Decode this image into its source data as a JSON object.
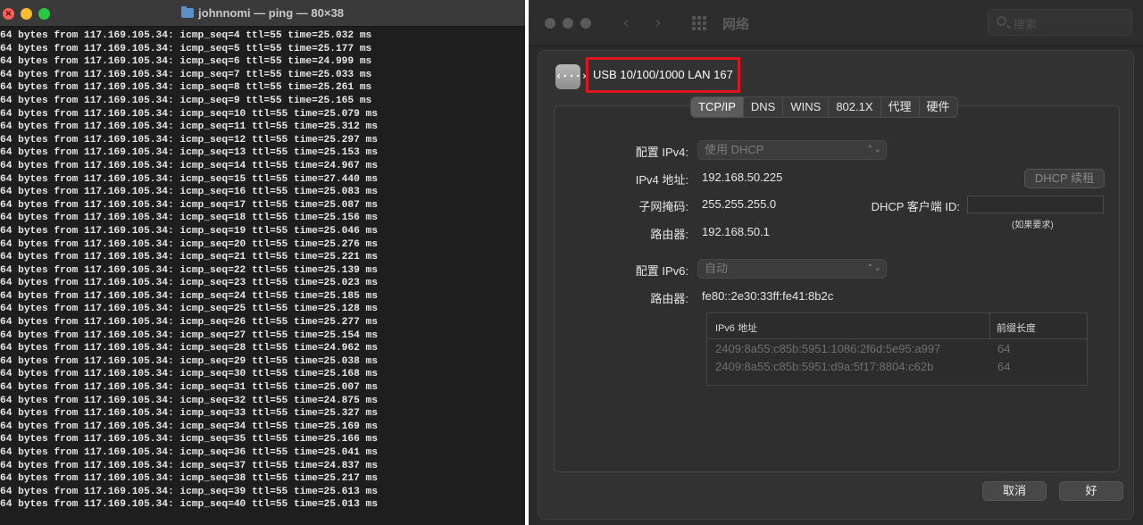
{
  "terminal": {
    "title": "johnnomi — ping — 80×38",
    "lines": [
      "64 bytes from 117.169.105.34: icmp_seq=4 ttl=55 time=25.032 ms",
      "64 bytes from 117.169.105.34: icmp_seq=5 ttl=55 time=25.177 ms",
      "64 bytes from 117.169.105.34: icmp_seq=6 ttl=55 time=24.999 ms",
      "64 bytes from 117.169.105.34: icmp_seq=7 ttl=55 time=25.033 ms",
      "64 bytes from 117.169.105.34: icmp_seq=8 ttl=55 time=25.261 ms",
      "64 bytes from 117.169.105.34: icmp_seq=9 ttl=55 time=25.165 ms",
      "64 bytes from 117.169.105.34: icmp_seq=10 ttl=55 time=25.079 ms",
      "64 bytes from 117.169.105.34: icmp_seq=11 ttl=55 time=25.312 ms",
      "64 bytes from 117.169.105.34: icmp_seq=12 ttl=55 time=25.297 ms",
      "64 bytes from 117.169.105.34: icmp_seq=13 ttl=55 time=25.153 ms",
      "64 bytes from 117.169.105.34: icmp_seq=14 ttl=55 time=24.967 ms",
      "64 bytes from 117.169.105.34: icmp_seq=15 ttl=55 time=27.440 ms",
      "64 bytes from 117.169.105.34: icmp_seq=16 ttl=55 time=25.083 ms",
      "64 bytes from 117.169.105.34: icmp_seq=17 ttl=55 time=25.087 ms",
      "64 bytes from 117.169.105.34: icmp_seq=18 ttl=55 time=25.156 ms",
      "64 bytes from 117.169.105.34: icmp_seq=19 ttl=55 time=25.046 ms",
      "64 bytes from 117.169.105.34: icmp_seq=20 ttl=55 time=25.276 ms",
      "64 bytes from 117.169.105.34: icmp_seq=21 ttl=55 time=25.221 ms",
      "64 bytes from 117.169.105.34: icmp_seq=22 ttl=55 time=25.139 ms",
      "64 bytes from 117.169.105.34: icmp_seq=23 ttl=55 time=25.023 ms",
      "64 bytes from 117.169.105.34: icmp_seq=24 ttl=55 time=25.185 ms",
      "64 bytes from 117.169.105.34: icmp_seq=25 ttl=55 time=25.128 ms",
      "64 bytes from 117.169.105.34: icmp_seq=26 ttl=55 time=25.277 ms",
      "64 bytes from 117.169.105.34: icmp_seq=27 ttl=55 time=25.154 ms",
      "64 bytes from 117.169.105.34: icmp_seq=28 ttl=55 time=24.962 ms",
      "64 bytes from 117.169.105.34: icmp_seq=29 ttl=55 time=25.038 ms",
      "64 bytes from 117.169.105.34: icmp_seq=30 ttl=55 time=25.168 ms",
      "64 bytes from 117.169.105.34: icmp_seq=31 ttl=55 time=25.007 ms",
      "64 bytes from 117.169.105.34: icmp_seq=32 ttl=55 time=24.875 ms",
      "64 bytes from 117.169.105.34: icmp_seq=33 ttl=55 time=25.327 ms",
      "64 bytes from 117.169.105.34: icmp_seq=34 ttl=55 time=25.169 ms",
      "64 bytes from 117.169.105.34: icmp_seq=35 ttl=55 time=25.166 ms",
      "64 bytes from 117.169.105.34: icmp_seq=36 ttl=55 time=25.041 ms",
      "64 bytes from 117.169.105.34: icmp_seq=37 ttl=55 time=24.837 ms",
      "64 bytes from 117.169.105.34: icmp_seq=38 ttl=55 time=25.217 ms",
      "64 bytes from 117.169.105.34: icmp_seq=39 ttl=55 time=25.613 ms",
      "64 bytes from 117.169.105.34: icmp_seq=40 ttl=55 time=25.013 ms"
    ]
  },
  "network": {
    "toolbar": {
      "back_icon": "‹",
      "forward_icon": "›",
      "title": "网络",
      "search_placeholder": "搜索"
    },
    "interface": {
      "icon_glyph": "‹···›",
      "name": "USB 10/100/1000 LAN 167"
    },
    "tabs": [
      "TCP/IP",
      "DNS",
      "WINS",
      "802.1X",
      "代理",
      "硬件"
    ],
    "active_tab": "TCP/IP",
    "ipv4": {
      "config_label": "配置 IPv4:",
      "config_value": "使用 DHCP",
      "address_label": "IPv4 地址:",
      "address": "192.168.50.225",
      "renew_button": "DHCP 续租",
      "subnet_label": "子网掩码:",
      "subnet": "255.255.255.0",
      "client_id_label": "DHCP 客户端 ID:",
      "client_id_value": "",
      "client_id_hint": "(如果要求)",
      "router_label": "路由器:",
      "router": "192.168.50.1"
    },
    "ipv6": {
      "config_label": "配置 IPv6:",
      "config_value": "自动",
      "router_label": "路由器:",
      "router": "fe80::2e30:33ff:fe41:8b2c",
      "table_headers": [
        "IPv6 地址",
        "前缀长度"
      ],
      "rows": [
        {
          "address": "2409:8a55:c85b:5951:1086:2f6d:5e95:a997",
          "prefix": "64"
        },
        {
          "address": "2409:8a55:c85b:5951:d9a:5f17:8804:c62b",
          "prefix": "64"
        }
      ]
    },
    "footer": {
      "help_glyph": "?",
      "cancel": "取消",
      "ok": "好"
    },
    "colors": {
      "highlight_box": "#e0141c",
      "close_light": "#ff5f57",
      "minimize_light": "#febc2e",
      "maximize_light": "#28c840"
    }
  }
}
